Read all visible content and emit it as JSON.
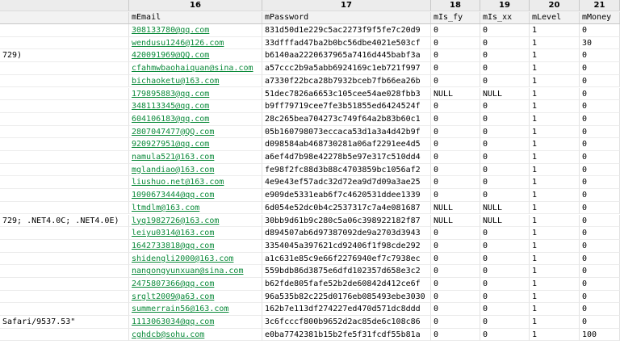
{
  "colors": {
    "email_link": "#0b8a3a",
    "header_bg": "#f2f2f2"
  },
  "columns": [
    {
      "number": "",
      "name": ""
    },
    {
      "number": "16",
      "name": "mEmail"
    },
    {
      "number": "17",
      "name": "mPassword"
    },
    {
      "number": "18",
      "name": "mIs_fy"
    },
    {
      "number": "19",
      "name": "mIs_xx"
    },
    {
      "number": "20",
      "name": "mLevel"
    },
    {
      "number": "21",
      "name": "mMoney"
    }
  ],
  "rows": [
    {
      "ua": "",
      "email": "308133780@qq.com",
      "password": "831d50d1e229c5ac2273f9f5fe7c20d9",
      "is_fy": "0",
      "is_xx": "0",
      "level": "1",
      "money": "0"
    },
    {
      "ua": "",
      "email": "wendusu1246@126.com",
      "password": "33dfffad47ba2b0bc56dbe4021e503cf",
      "is_fy": "0",
      "is_xx": "0",
      "level": "1",
      "money": "30"
    },
    {
      "ua": "729)",
      "email": "420091969@QQ.com",
      "password": "b6140aa2220637965a7416d445babf3a",
      "is_fy": "0",
      "is_xx": "0",
      "level": "1",
      "money": "0"
    },
    {
      "ua": "",
      "email": "cfahmwbaohaiquan@sina.com",
      "password": "a57ccc2b9a5abb6924169c1eb721f997",
      "is_fy": "0",
      "is_xx": "0",
      "level": "1",
      "money": "0"
    },
    {
      "ua": "",
      "email": "bichaoketu@163.com",
      "password": "a7330f22bca28b7932bceb7fb66ea26b",
      "is_fy": "0",
      "is_xx": "0",
      "level": "1",
      "money": "0"
    },
    {
      "ua": "",
      "email": "179895883@qq.com",
      "password": "51dec7826a6653c105cee54ae028fbb3",
      "is_fy": "NULL",
      "is_xx": "NULL",
      "level": "1",
      "money": "0"
    },
    {
      "ua": "",
      "email": "348113345@qq.com",
      "password": "b9ff79719cee7fe3b51855ed6424524f",
      "is_fy": "0",
      "is_xx": "0",
      "level": "1",
      "money": "0"
    },
    {
      "ua": "",
      "email": "604106183@qq.com",
      "password": "28c265bea704273c749f64a2b83b60c1",
      "is_fy": "0",
      "is_xx": "0",
      "level": "1",
      "money": "0"
    },
    {
      "ua": "",
      "email": "2807047477@QQ.com",
      "password": "05b160798073eccaca53d1a3a4d42b9f",
      "is_fy": "0",
      "is_xx": "0",
      "level": "1",
      "money": "0"
    },
    {
      "ua": "",
      "email": "920927951@qq.com",
      "password": "d098584ab468730281a06af2291ee4d5",
      "is_fy": "0",
      "is_xx": "0",
      "level": "1",
      "money": "0"
    },
    {
      "ua": "",
      "email": "namula521@163.com",
      "password": "a6ef4d7b98e42278b5e97e317c510dd4",
      "is_fy": "0",
      "is_xx": "0",
      "level": "1",
      "money": "0"
    },
    {
      "ua": "",
      "email": "mglandiao@163.com",
      "password": "fe98f2fc88d3b88c4703859bc1056af2",
      "is_fy": "0",
      "is_xx": "0",
      "level": "1",
      "money": "0"
    },
    {
      "ua": "",
      "email": "liushuo.net@163.com",
      "password": "4e9e43ef57adc32d72ea9d7d09a3ae25",
      "is_fy": "0",
      "is_xx": "0",
      "level": "1",
      "money": "0"
    },
    {
      "ua": "",
      "email": "1090673444@qq.com",
      "password": "e909de5331eab6f7c4620531ddee1339",
      "is_fy": "0",
      "is_xx": "0",
      "level": "1",
      "money": "0"
    },
    {
      "ua": "",
      "email": "ltmdlm@163.com",
      "password": "6d054e52dc0b4c2537317c7a4e081687",
      "is_fy": "NULL",
      "is_xx": "NULL",
      "level": "1",
      "money": "0"
    },
    {
      "ua": "729; .NET4.0C; .NET4.0E)",
      "email": "lyq1982726@163.com",
      "password": "30bb9d61b9c280c5a06c398922182f87",
      "is_fy": "NULL",
      "is_xx": "NULL",
      "level": "1",
      "money": "0"
    },
    {
      "ua": "",
      "email": "leiyu0314@163.com",
      "password": "d894507ab6d97387092de9a2703d3943",
      "is_fy": "0",
      "is_xx": "0",
      "level": "1",
      "money": "0"
    },
    {
      "ua": "",
      "email": "1642733818@qq.com",
      "password": "3354045a397621cd92406f1f98cde292",
      "is_fy": "0",
      "is_xx": "0",
      "level": "1",
      "money": "0"
    },
    {
      "ua": "",
      "email": "shidengli2000@163.com",
      "password": "a1c631e85c9e66f2276940ef7c7938ec",
      "is_fy": "0",
      "is_xx": "0",
      "level": "1",
      "money": "0"
    },
    {
      "ua": "",
      "email": "nangongyunxuan@sina.com",
      "password": "559bdb86d3875e6dfd102357d658e3c2",
      "is_fy": "0",
      "is_xx": "0",
      "level": "1",
      "money": "0"
    },
    {
      "ua": "",
      "email": "2475807366@qq.com",
      "password": "b62fde805fafe52b2de60842d412ce6f",
      "is_fy": "0",
      "is_xx": "0",
      "level": "1",
      "money": "0"
    },
    {
      "ua": "",
      "email": "srglt2009@a63.com",
      "password": "96a535b82c225d0176eb085493ebe3030",
      "is_fy": "0",
      "is_xx": "0",
      "level": "1",
      "money": "0"
    },
    {
      "ua": "",
      "email": "summerrain56@163.com",
      "password": "162b7e113df274227ed470d571dc8ddd",
      "is_fy": "0",
      "is_xx": "0",
      "level": "1",
      "money": "0"
    },
    {
      "ua": "Safari/9537.53\"",
      "email": "1113063034@qq.com",
      "password": "3c6fcccf800b9652d2ac85de6c108c86",
      "is_fy": "0",
      "is_xx": "0",
      "level": "1",
      "money": "0"
    },
    {
      "ua": "",
      "email": "cghdcb@sohu.com",
      "password": "e0ba7742381b15b2fe5f31fcdf55b81a",
      "is_fy": "0",
      "is_xx": "0",
      "level": "1",
      "money": "100"
    }
  ]
}
